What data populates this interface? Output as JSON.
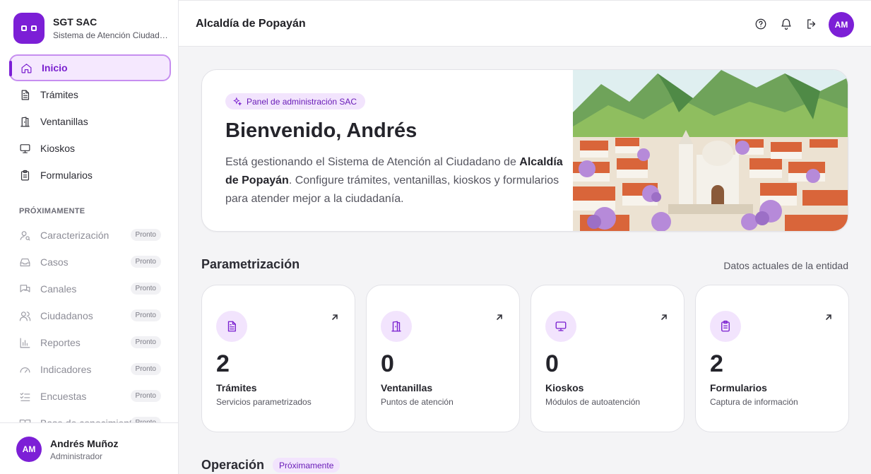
{
  "brand": {
    "name": "SGT SAC",
    "subtitle": "Sistema de Atención Ciudadana"
  },
  "nav": [
    {
      "label": "Inicio",
      "icon": "home-icon",
      "active": true
    },
    {
      "label": "Trámites",
      "icon": "document-icon"
    },
    {
      "label": "Ventanillas",
      "icon": "door-icon"
    },
    {
      "label": "Kioskos",
      "icon": "monitor-icon"
    },
    {
      "label": "Formularios",
      "icon": "clipboard-icon"
    }
  ],
  "soon": {
    "title": "PRÓXIMAMENTE",
    "badge": "Pronto",
    "items": [
      {
        "label": "Caracterización",
        "icon": "user-search-icon"
      },
      {
        "label": "Casos",
        "icon": "inbox-icon"
      },
      {
        "label": "Canales",
        "icon": "chat-icon"
      },
      {
        "label": "Ciudadanos",
        "icon": "users-icon"
      },
      {
        "label": "Reportes",
        "icon": "bar-chart-icon"
      },
      {
        "label": "Indicadores",
        "icon": "gauge-icon"
      },
      {
        "label": "Encuestas",
        "icon": "checklist-icon"
      },
      {
        "label": "Base de conocimiento",
        "icon": "book-icon"
      }
    ]
  },
  "user": {
    "initials": "AM",
    "name": "Andrés Muñoz",
    "role": "Administrador"
  },
  "header": {
    "title": "Alcaldía de Popayán",
    "initials": "AM"
  },
  "hero": {
    "chip": "Panel de administración SAC",
    "title": "Bienvenido, Andrés",
    "text_before": "Está gestionando el Sistema de Atención al Ciudadano de ",
    "entity": "Alcaldía de Popayán",
    "text_after": ". Configure trámites, ventanillas, kioskos y formularios para atender mejor a la ciudadanía."
  },
  "param": {
    "title": "Parametrización",
    "right": "Datos actuales de la entidad",
    "cards": [
      {
        "value": "2",
        "label": "Trámites",
        "sub": "Servicios parametrizados",
        "icon": "document-icon"
      },
      {
        "value": "0",
        "label": "Ventanillas",
        "sub": "Puntos de atención",
        "icon": "door-icon"
      },
      {
        "value": "0",
        "label": "Kioskos",
        "sub": "Módulos de autoatención",
        "icon": "monitor-icon"
      },
      {
        "value": "2",
        "label": "Formularios",
        "sub": "Captura de información",
        "icon": "clipboard-icon"
      }
    ]
  },
  "operation": {
    "title": "Operación",
    "chip": "Próximamente"
  },
  "colors": {
    "accent": "#7c1fd6",
    "accent_soft": "#f2e4fd"
  }
}
